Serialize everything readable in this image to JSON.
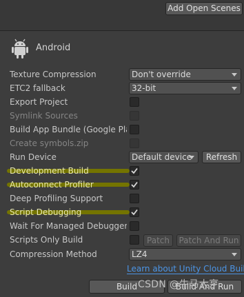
{
  "header": {
    "add_open_scenes_label": "Add Open Scenes"
  },
  "platform": {
    "name": "Android",
    "icon": "android-icon"
  },
  "settings": {
    "texture_compression": {
      "label": "Texture Compression",
      "value": "Don't override"
    },
    "etc2_fallback": {
      "label": "ETC2 fallback",
      "value": "32-bit"
    },
    "export_project": {
      "label": "Export Project",
      "checked": false
    },
    "symlink_sources": {
      "label": "Symlink Sources",
      "checked": false,
      "disabled": true
    },
    "build_app_bundle": {
      "label": "Build App Bundle (Google Play",
      "checked": false
    },
    "create_symbols": {
      "label": "Create symbols.zip",
      "disabled": true
    },
    "run_device": {
      "label": "Run Device",
      "value": "Default device",
      "refresh_label": "Refresh"
    },
    "development_build": {
      "label": "Development Build",
      "checked": true
    },
    "autoconnect_profiler": {
      "label": "Autoconnect Profiler",
      "checked": true
    },
    "deep_profiling": {
      "label": "Deep Profiling Support",
      "checked": false
    },
    "script_debugging": {
      "label": "Script Debugging",
      "checked": true
    },
    "wait_for_debugger": {
      "label": "Wait For Managed Debugger",
      "checked": false
    },
    "scripts_only_build": {
      "label": "Scripts Only Build",
      "checked": false,
      "patch_label": "Patch",
      "patch_and_run_label": "Patch And Run"
    },
    "compression_method": {
      "label": "Compression Method",
      "value": "LZ4"
    }
  },
  "cloud_link": "Learn about Unity Cloud Build",
  "footer": {
    "build_label": "Build",
    "build_and_run_label": "Build And Run"
  },
  "watermark": "CSDN @牛马大亨",
  "colors": {
    "background": "#383838",
    "panel": "#3d3d3d",
    "highlight": "#6b6b00",
    "link": "#4c95e6"
  }
}
